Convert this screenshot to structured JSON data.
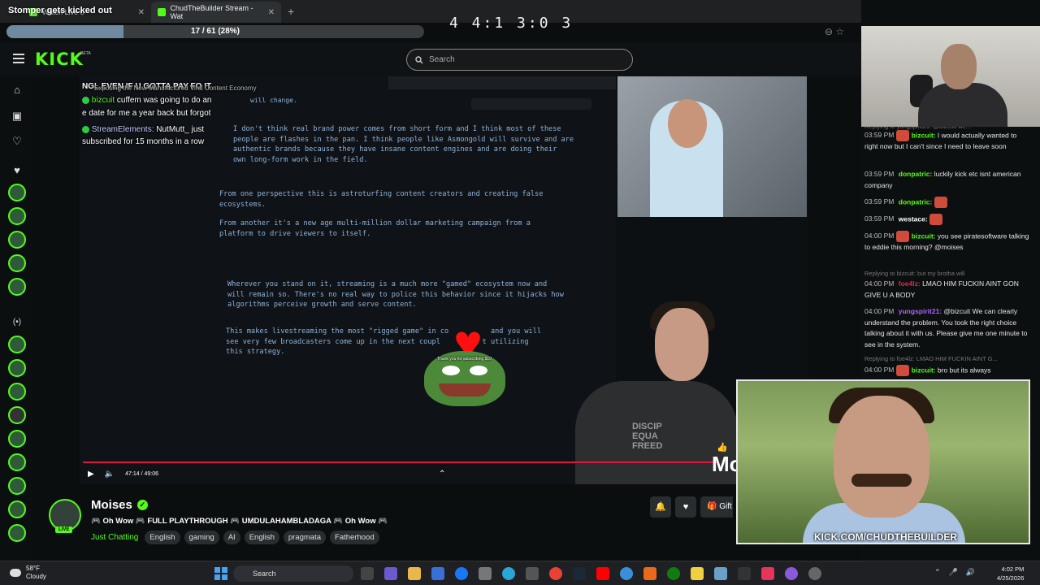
{
  "overlay": {
    "title": "Stomper gets kicked out",
    "clock": "4 4:1 3:0 3"
  },
  "browser": {
    "tabs": [
      {
        "label": "Watch Live o",
        "close": "✕"
      },
      {
        "label": "ChudTheBuilder Stream - Wat",
        "close": "✕"
      }
    ],
    "new_tab": "+"
  },
  "progress": {
    "text": "17 / 61 (28%)",
    "fraction": 0.28
  },
  "header": {
    "logo": "KICK",
    "beta": "BETA",
    "search_placeholder": "Search"
  },
  "stream_overlay": {
    "banner": "NGL EVEN IF U GOTTA PAY FO IT",
    "window_title": "Exposing the New Manufactured Viral Content Economy",
    "chat1_user": "bizcuit",
    "chat1_msg": "cuffem was going to do an",
    "chat1_cont": "e date for me a year back but forgot",
    "chat2_user": "StreamElements:",
    "chat2_msg": "NutMutt_ just",
    "chat2_cont": "subscribed for 15 months in a row",
    "will_change": "will change.",
    "note1": "I don't think real brand power comes from short form and I think most of these\npeople are flashes in the pan. I think people like Asmongold will survive and are\nauthentic brands because they have insane content engines and are doing their\nown long-form work in the field.",
    "note2": "From one perspective this is astroturfing content creators and creating false\necosystems.",
    "note3": "From another it's a new age multi-million dollar marketing campaign from a\nplatform to drive viewers to itself.",
    "note4": "Wherever you stand on it, streaming is a much more \"gamed\" ecosystem now and\nwill remain so. There's no real way to police this behavior since it hijacks how\nalgorithms perceive growth and serve content.",
    "note5": "This makes livestreaming the most \"rigged game\" in co          and you will\nsee very few broadcasters come up in the next coupl          t utilizing\nthis strategy.",
    "sub_alert": "Thank you for subscribing $10",
    "shirt": "DISCIP\nEQUA\nFREED",
    "mo_text": "Mo"
  },
  "player": {
    "time": "47:14 / 49:06"
  },
  "channel": {
    "name": "Moises",
    "live": "LIVE",
    "title": "🎮 Oh Wow 🎮 FULL PLAYTHROUGH 🎮 UMDULAHAMBLADAGA 🎮 Oh Wow 🎮",
    "category": "Just Chatting",
    "tags": [
      "English",
      "gaming",
      "AI",
      "English",
      "pragmata",
      "Fatherhood"
    ],
    "gift": "Gift"
  },
  "chat": {
    "messages": [
      {
        "reply": "Replying to yungspirit21: @bizcuit we..."
      },
      {
        "time": "03:59 PM",
        "user": "bizcuit:",
        "color": "#53fc18",
        "text": "I would actually wanted to right now but I can't since I need to leave soon"
      },
      {
        "time": "03:59 PM",
        "user": "donpatric:",
        "color": "#53fc18",
        "text": "luckily kick etc isnt american company"
      },
      {
        "time": "03:59 PM",
        "user": "donpatric:",
        "color": "#53fc18",
        "text": ""
      },
      {
        "time": "03:59 PM",
        "user": "westace:",
        "color": "#ffffff",
        "text": ""
      },
      {
        "time": "04:00 PM",
        "user": "bizcuit:",
        "color": "#53fc18",
        "text": "you see piratesoftware talking to eddie this morning? @moises"
      },
      {
        "reply": "Replying to bizcuit: but my brotha will"
      },
      {
        "time": "04:00 PM",
        "user": "foe4lz:",
        "color": "#e0284a",
        "text": "LMAO HIM FUCKIN AINT GON GIVE U A BODY"
      },
      {
        "time": "04:00 PM",
        "user": "yungspirit21:",
        "color": "#b060ff",
        "text": "@bizcuit We can clearly understand the problem. You took the right choice talking about it with us. Please give me one minute to see in the system."
      },
      {
        "reply": "Replying to foe4lz: LMAO HIM FUCKIN AINT G..."
      },
      {
        "time": "04:00 PM",
        "user": "bizcuit:",
        "color": "#53fc18",
        "text": "bro but its always"
      }
    ]
  },
  "cam4": {
    "url": "KICK.COM/CHUDTHEBUILDER"
  },
  "taskbar": {
    "weather_temp": "58°F",
    "weather_desc": "Cloudy",
    "search": "Search",
    "time": "4:02 PM",
    "date": "4/25/2026"
  }
}
